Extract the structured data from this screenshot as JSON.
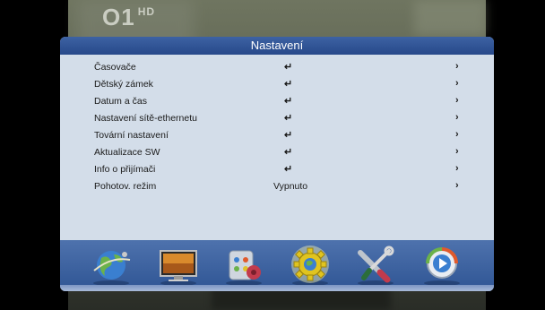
{
  "channel": {
    "logo_text": "O1",
    "hd_text": "HD"
  },
  "menu": {
    "title": "Nastavení",
    "items": [
      {
        "label": "Časovače",
        "value": "",
        "enter": "↵",
        "arrow": "›"
      },
      {
        "label": "Dětský zámek",
        "value": "",
        "enter": "↵",
        "arrow": "›"
      },
      {
        "label": "Datum a čas",
        "value": "",
        "enter": "↵",
        "arrow": "›"
      },
      {
        "label": "Nastavení sítě-ethernetu",
        "value": "",
        "enter": "↵",
        "arrow": "›"
      },
      {
        "label": "Tovární nastavení",
        "value": "",
        "enter": "↵",
        "arrow": "›"
      },
      {
        "label": "Aktualizace SW",
        "value": "",
        "enter": "↵",
        "arrow": "›"
      },
      {
        "label": "Info o přijímači",
        "value": "",
        "enter": "↵",
        "arrow": "›"
      },
      {
        "label": "Pohotov. režim",
        "value": "Vypnuto",
        "enter": "",
        "arrow": "›"
      }
    ]
  },
  "icons": [
    {
      "name": "globe-satellite-icon",
      "selected": false
    },
    {
      "name": "monitor-icon",
      "selected": false
    },
    {
      "name": "media-icon",
      "selected": false
    },
    {
      "name": "settings-gear-icon",
      "selected": true
    },
    {
      "name": "tools-icon",
      "selected": false
    },
    {
      "name": "play-icon",
      "selected": false
    }
  ],
  "colors": {
    "panel_bg": "#d3dde9",
    "title_bar": "#2f5190",
    "icon_bar": "#3d62a3"
  }
}
